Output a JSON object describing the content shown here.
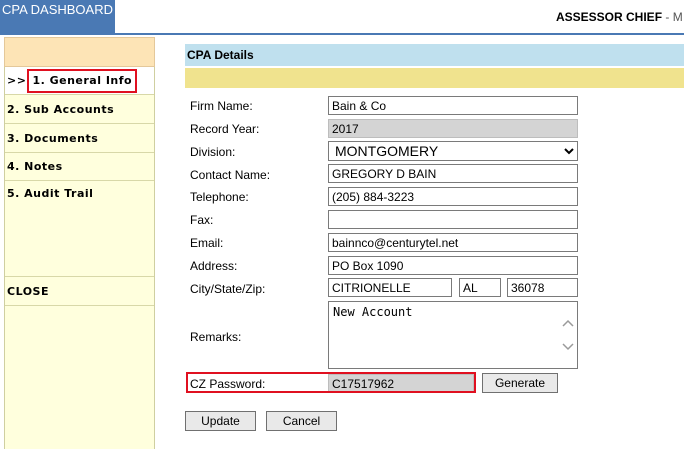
{
  "header": {
    "dashboard_label": "CPA DASHBOARD",
    "user_bold": "ASSESSOR CHIEF",
    "user_rest": " - M"
  },
  "sidebar": {
    "active_prefix": ">>",
    "items": [
      {
        "label": "1. General Info"
      },
      {
        "label": "2. Sub Accounts"
      },
      {
        "label": "3. Documents"
      },
      {
        "label": "4. Notes"
      },
      {
        "label": "5. Audit Trail"
      }
    ],
    "close_label": "CLOSE"
  },
  "section": {
    "title": "CPA Details"
  },
  "form": {
    "firm_name": {
      "label": "Firm Name:",
      "value": "Bain & Co"
    },
    "record_year": {
      "label": "Record Year:",
      "value": "2017"
    },
    "division": {
      "label": "Division:",
      "value": "MONTGOMERY"
    },
    "contact_name": {
      "label": "Contact Name:",
      "value": "GREGORY D BAIN"
    },
    "telephone": {
      "label": "Telephone:",
      "value": "(205) 884-3223"
    },
    "fax": {
      "label": "Fax:",
      "value": ""
    },
    "email": {
      "label": "Email:",
      "value": "bainnco@centurytel.net"
    },
    "address": {
      "label": "Address:",
      "value": "PO Box 1090"
    },
    "city_state_zip": {
      "label": "City/State/Zip:",
      "city": "CITRIONELLE",
      "state": "AL",
      "zip": "36078"
    },
    "remarks": {
      "label": "Remarks:",
      "value": "New Account"
    },
    "cz_password": {
      "label": "CZ Password:",
      "value": "C17517962"
    }
  },
  "buttons": {
    "generate": "Generate",
    "update": "Update",
    "cancel": "Cancel"
  },
  "colors": {
    "header_blue": "#4a79b4",
    "section_blue": "#bfe0ee",
    "section_yellow": "#f0e38e",
    "sidebar_bg": "#ffffdd",
    "highlight_red": "#e01020"
  }
}
